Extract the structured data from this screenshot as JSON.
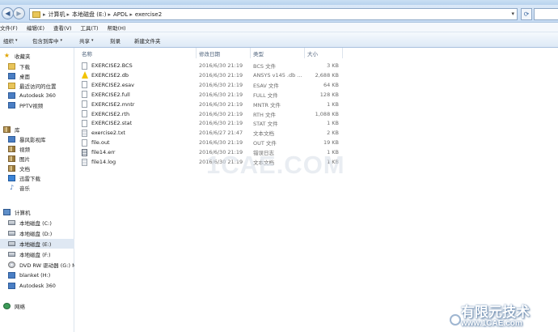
{
  "address": {
    "crumbs": [
      "计算机",
      "本地磁盘 (E:)",
      "APDL",
      "exercise2"
    ]
  },
  "menu": [
    "文件(F)",
    "编辑(E)",
    "查看(V)",
    "工具(T)",
    "帮助(H)"
  ],
  "toolbar": {
    "organize": "组织",
    "include_library": "包含到库中",
    "share": "共享",
    "burn": "刻录",
    "new_folder": "新建文件夹"
  },
  "nav": {
    "favorites": "收藏夹",
    "downloads": "下载",
    "desktop": "桌面",
    "recent": "最近访问的位置",
    "autodesk360_fav": "Autodesk 360",
    "pptv": "PPTV视频",
    "libraries": "库",
    "baofeng": "暴风影视库",
    "videos": "视频",
    "pictures": "图片",
    "documents": "文档",
    "thunder": "迅雷下载",
    "music": "音乐",
    "computer": "计算机",
    "drive_c": "本地磁盘 (C:)",
    "drive_d": "本地磁盘 (D:)",
    "drive_e": "本地磁盘 (E:)",
    "drive_f": "本地磁盘 (F:)",
    "dvd": "DVD RW 驱动器 (G:) M",
    "blanket": "blanket (H:)",
    "autodesk360_pc": "Autodesk 360",
    "network": "网络"
  },
  "columns": {
    "name": "名称",
    "date": "修改日期",
    "type": "类型",
    "size": "大小"
  },
  "files": [
    {
      "name": "EXERCISE2.BCS",
      "date": "2016/6/30 21:19",
      "type": "BCS 文件",
      "size": "3 KB",
      "icon": "file-icon"
    },
    {
      "name": "EXERCISE2.db",
      "date": "2016/6/30 21:19",
      "type": "ANSYS v145 .db ...",
      "size": "2,688 KB",
      "icon": "ansys-icon"
    },
    {
      "name": "EXERCISE2.esav",
      "date": "2016/6/30 21:19",
      "type": "ESAV 文件",
      "size": "64 KB",
      "icon": "file-icon"
    },
    {
      "name": "EXERCISE2.full",
      "date": "2016/6/30 21:19",
      "type": "FULL 文件",
      "size": "128 KB",
      "icon": "file-icon"
    },
    {
      "name": "EXERCISE2.mntr",
      "date": "2016/6/30 21:19",
      "type": "MNTR 文件",
      "size": "1 KB",
      "icon": "file-icon"
    },
    {
      "name": "EXERCISE2.rth",
      "date": "2016/6/30 21:19",
      "type": "RTH 文件",
      "size": "1,088 KB",
      "icon": "file-icon"
    },
    {
      "name": "EXERCISE2.stat",
      "date": "2016/6/30 21:19",
      "type": "STAT 文件",
      "size": "1 KB",
      "icon": "file-icon"
    },
    {
      "name": "exercise2.txt",
      "date": "2016/6/27 21:47",
      "type": "文本文档",
      "size": "2 KB",
      "icon": "text-file-icon"
    },
    {
      "name": "file.out",
      "date": "2016/6/30 21:19",
      "type": "OUT 文件",
      "size": "19 KB",
      "icon": "file-icon"
    },
    {
      "name": "file14.err",
      "date": "2016/6/30 21:19",
      "type": "错误日志",
      "size": "1 KB",
      "icon": "error-log-icon"
    },
    {
      "name": "file14.log",
      "date": "2016/6/30 21:19",
      "type": "文本文档",
      "size": "1 KB",
      "icon": "text-file-icon"
    }
  ],
  "watermark": {
    "main": "1CAE.COM",
    "logo": "有限元技术",
    "url": "www.1CAE.com"
  }
}
